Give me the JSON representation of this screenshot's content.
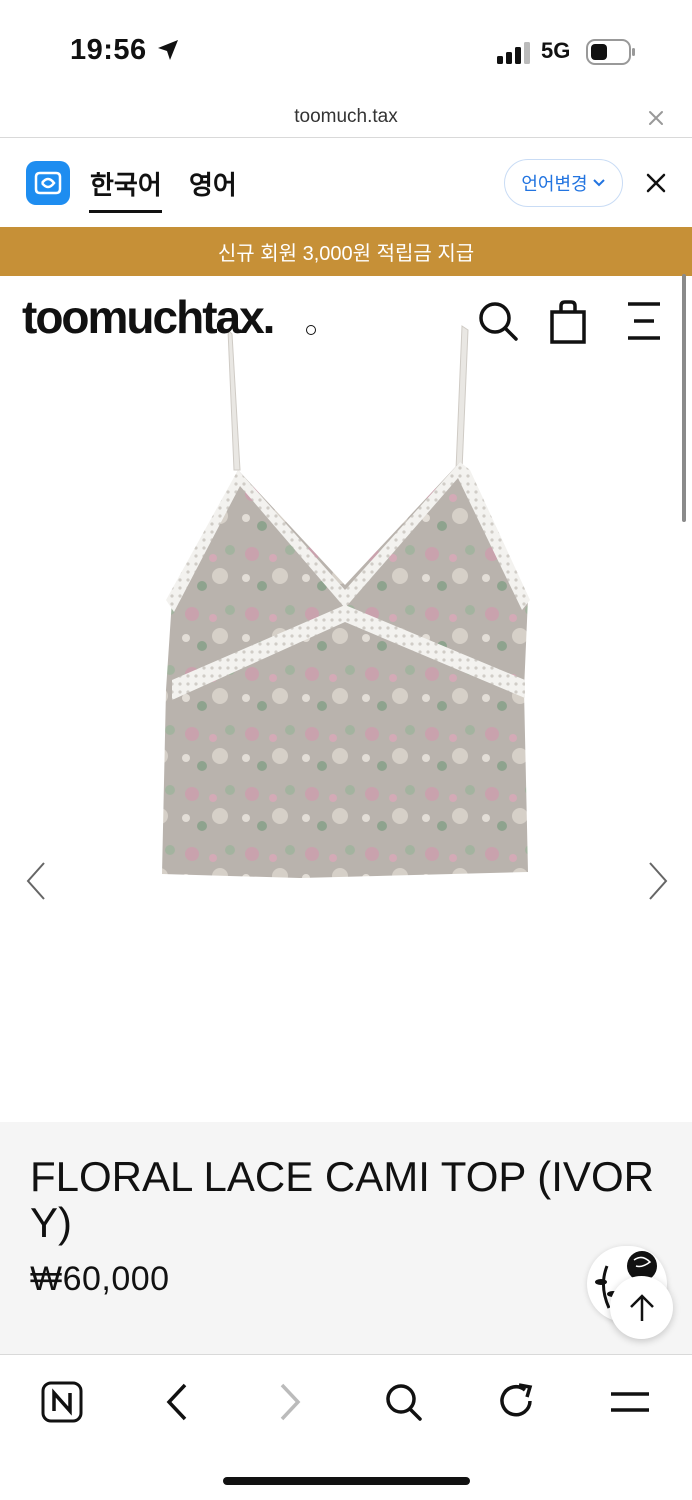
{
  "status_bar": {
    "time": "19:56",
    "network": "5G",
    "icons": [
      "location-arrow-icon",
      "signal-icon",
      "battery-icon"
    ]
  },
  "browser": {
    "url": "toomuch.tax"
  },
  "translate_bar": {
    "tabs": [
      {
        "label": "한국어",
        "active": true
      },
      {
        "label": "영어",
        "active": false
      }
    ],
    "change_language_label": "언어변경",
    "accent_color": "#1e8df0"
  },
  "promo_banner": {
    "text": "신규 회원 3,000원 적립금 지급",
    "background": "#c69037"
  },
  "site_header": {
    "brand": "toomuchtax.",
    "icons": [
      "search-icon",
      "shopping-bag-icon",
      "menu-icon"
    ]
  },
  "product": {
    "title": "FLORAL LACE CAMI TOP (IVORY)",
    "price": "₩60,000"
  },
  "toolbar": {
    "icons": [
      "naver-home-icon",
      "back-icon",
      "forward-icon",
      "search-icon",
      "reload-icon",
      "menu-icon"
    ]
  }
}
